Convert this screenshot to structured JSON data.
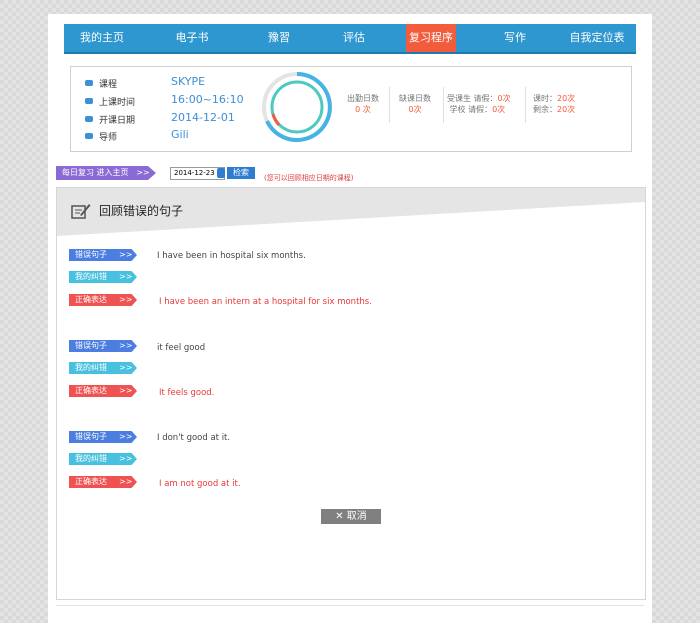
{
  "nav": {
    "items": [
      "我的主页",
      "电子书",
      "豫習",
      "评估",
      "复习程序",
      "写作",
      "自我定位表"
    ],
    "active_index": 4,
    "colors": {
      "bar": "#2f97cf",
      "active": "#f25b3c"
    }
  },
  "course_info": {
    "rows": [
      {
        "label": "课程",
        "value": "SKYPE"
      },
      {
        "label": "上课时间",
        "value": "16:00~16:10"
      },
      {
        "label": "开课日期",
        "value": "2014-12-01"
      },
      {
        "label": "导师",
        "value": "Gili"
      }
    ],
    "stats": {
      "attend_label": "出勤日数",
      "attend_value": "0 次",
      "absent_label": "缺课日数",
      "absent_value": "0次",
      "student_leave_label": "受课生 请假：",
      "student_leave_value": "0次",
      "school_leave_label": "学校 请假：",
      "school_leave_value": "0次",
      "lessons_label": "课时：",
      "lessons_value": "20次",
      "remaining_label": "剩余：",
      "remaining_value": "20次"
    }
  },
  "toolbar": {
    "daily_label": "每日复习 进入主页",
    "daily_chevron": ">>",
    "date_value": "2014-12-23",
    "search_label": "检索",
    "hint": "(您可以回顾相应日期的课程)"
  },
  "review": {
    "title": "回顾错误的句子",
    "tag_wrong": "错误句子",
    "tag_mine": "我的纠错",
    "tag_right": "正确表达",
    "chevron": ">>",
    "items": [
      {
        "wrong": "I have been in hospital six months.",
        "mine": "",
        "right": "I have been an intern at a hospital for six months."
      },
      {
        "wrong": "it feel good",
        "mine": "",
        "right": "It feels good."
      },
      {
        "wrong": "I don't good at it.",
        "mine": "",
        "right": "I am not good at it."
      }
    ],
    "cancel_label": "取消"
  }
}
